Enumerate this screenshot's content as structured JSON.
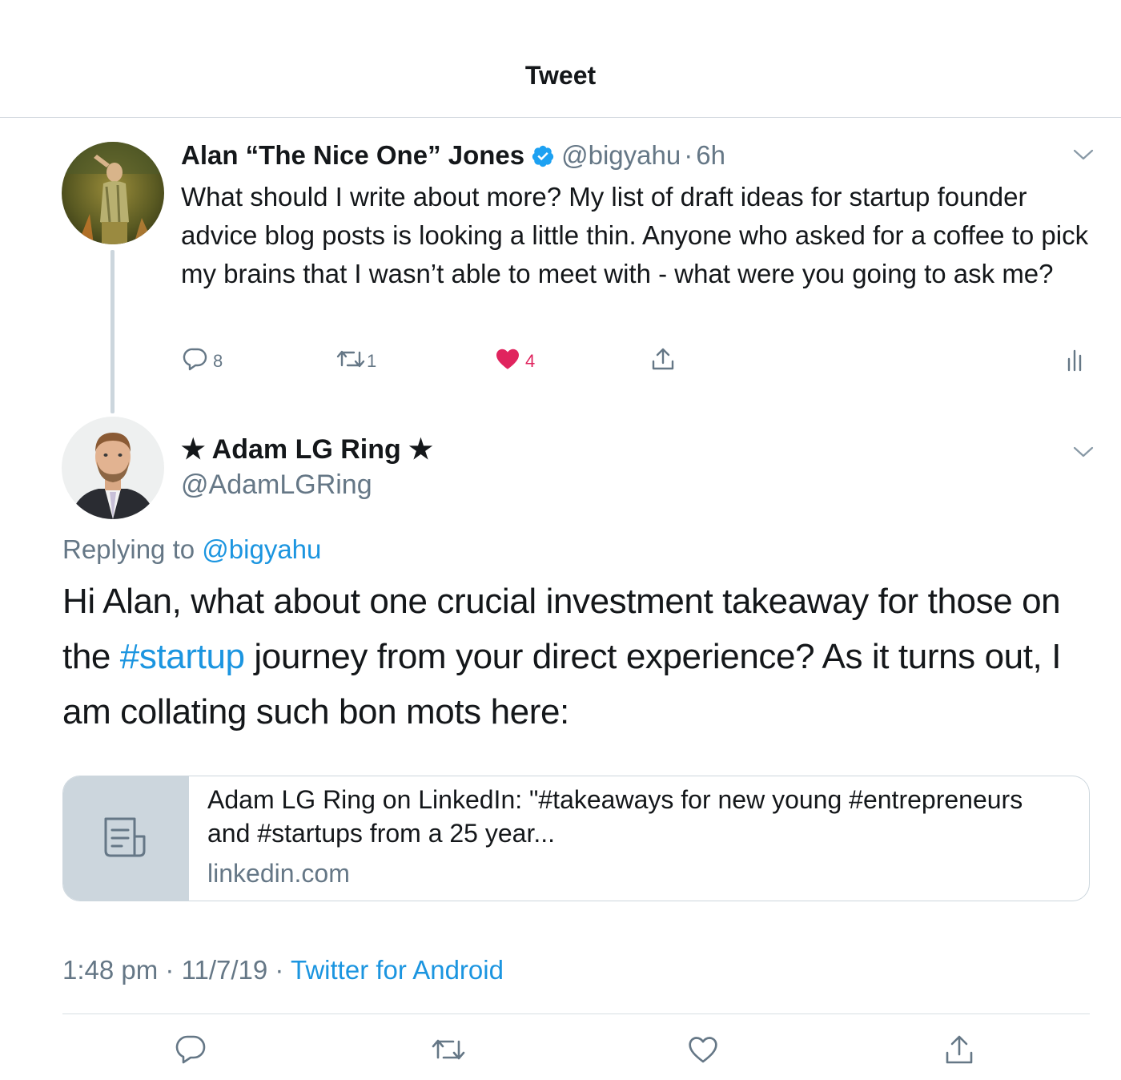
{
  "header": {
    "title": "Tweet"
  },
  "tweet1": {
    "name": "Alan “The Nice One” Jones",
    "handle": "@bigyahu",
    "separator": "·",
    "time": "6h",
    "text": "What should I write about more? My list of draft ideas for startup founder advice blog posts is looking a little thin. Anyone who asked for a coffee to pick my brains that I wasn’t able to meet with - what were you going to ask me?",
    "actions": {
      "replies": "8",
      "retweets": "1",
      "likes": "4"
    }
  },
  "tweet2": {
    "name": "★ Adam LG Ring ★",
    "handle": "@AdamLGRing",
    "replying_prefix": "Replying to",
    "replying_to": "@bigyahu",
    "text_part1": "Hi Alan, what about one crucial investment takeaway for those on the ",
    "hashtag": "#startup",
    "text_part2": " journey from your direct experience? As it turns out, I am collating such bon mots here:",
    "card": {
      "title": "Adam LG Ring on LinkedIn: \"#takeaways for new young #entrepreneurs and #startups from a 25 year...",
      "domain": "linkedin.com"
    },
    "meta": {
      "time": "1:48 pm",
      "sep1": "·",
      "date": "11/7/19",
      "sep2": "·",
      "source": "Twitter for Android"
    }
  },
  "colors": {
    "link": "#1b95e0",
    "like": "#e0245e",
    "muted": "#657786",
    "verified": "#1da1f2"
  }
}
